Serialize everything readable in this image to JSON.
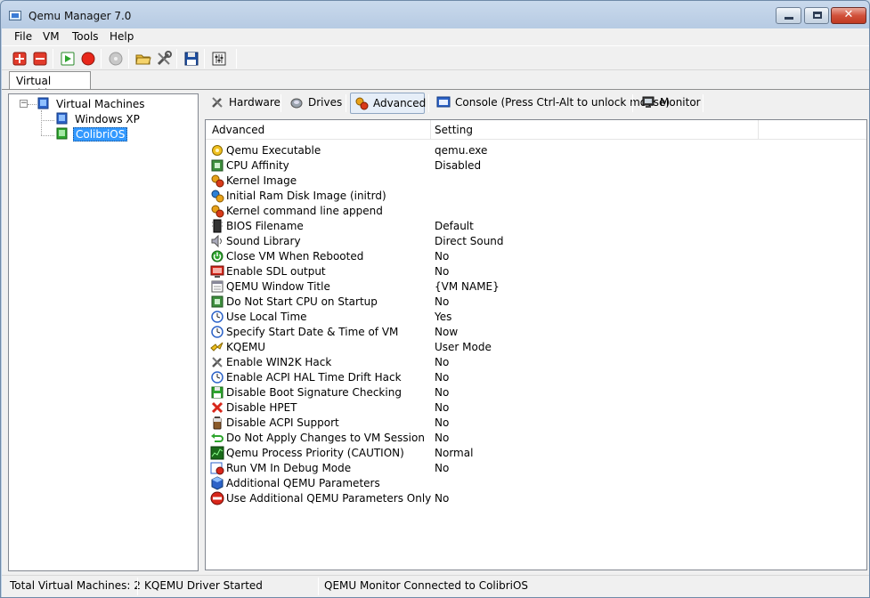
{
  "window": {
    "title": "Qemu Manager 7.0"
  },
  "menu": [
    "File",
    "VM",
    "Tools",
    "Help"
  ],
  "toolbar": {
    "buttons": [
      "add-vm",
      "remove-vm",
      "start-vm",
      "stop-vm",
      "cd-rom",
      "open-folder",
      "tools-settings",
      "save",
      "mixer-settings"
    ]
  },
  "main_tab": {
    "label": "Virtual Machines"
  },
  "tree": {
    "root": "Virtual Machines",
    "children": [
      {
        "label": "Windows XP",
        "selected": false
      },
      {
        "label": "ColibriOS",
        "selected": true
      }
    ]
  },
  "panel_tabs": [
    {
      "label": "Hardware",
      "icon": "wrench-screwdriver-icon",
      "active": false
    },
    {
      "label": "Drives",
      "icon": "drive-icon",
      "active": false
    },
    {
      "label": "Advanced",
      "icon": "gears-icon",
      "active": true
    },
    {
      "label": "Console (Press Ctrl-Alt to unlock mouse)",
      "icon": "console-icon",
      "active": false
    },
    {
      "label": "Monitor",
      "icon": "monitor-icon",
      "active": false
    }
  ],
  "list": {
    "columns": [
      "Advanced",
      "Setting"
    ],
    "rows": [
      {
        "name": "Qemu Executable",
        "value": "qemu.exe",
        "icon": "gear-yellow-icon"
      },
      {
        "name": "CPU Affinity",
        "value": "Disabled",
        "icon": "cpu-icon"
      },
      {
        "name": "Kernel Image",
        "value": "",
        "icon": "gears-red-icon"
      },
      {
        "name": "Initial Ram Disk Image (initrd)",
        "value": "",
        "icon": "gears-blue-icon"
      },
      {
        "name": "Kernel command line append",
        "value": "",
        "icon": "gears-red-icon"
      },
      {
        "name": "BIOS Filename",
        "value": "Default",
        "icon": "bios-chip-icon"
      },
      {
        "name": "Sound Library",
        "value": "Direct Sound",
        "icon": "speaker-icon"
      },
      {
        "name": "Close VM When Rebooted",
        "value": "No",
        "icon": "power-icon"
      },
      {
        "name": "Enable SDL output",
        "value": "No",
        "icon": "display-icon"
      },
      {
        "name": "QEMU Window Title",
        "value": "{VM NAME}",
        "icon": "window-icon"
      },
      {
        "name": "Do Not Start CPU on Startup",
        "value": "No",
        "icon": "cpu-icon"
      },
      {
        "name": "Use Local Time",
        "value": "Yes",
        "icon": "clock-icon"
      },
      {
        "name": "Specify Start Date & Time of VM",
        "value": "Now",
        "icon": "clock-icon"
      },
      {
        "name": "KQEMU",
        "value": "User Mode",
        "icon": "lightning-icon"
      },
      {
        "name": "Enable WIN2K Hack",
        "value": "No",
        "icon": "tools-icon"
      },
      {
        "name": "Enable ACPI HAL Time Drift Hack",
        "value": "No",
        "icon": "clock-icon"
      },
      {
        "name": "Disable Boot Signature Checking",
        "value": "No",
        "icon": "floppy-icon"
      },
      {
        "name": "Disable HPET",
        "value": "No",
        "icon": "red-x-icon"
      },
      {
        "name": "Disable ACPI Support",
        "value": "No",
        "icon": "battery-icon"
      },
      {
        "name": "Do Not Apply Changes to VM Session",
        "value": "No",
        "icon": "undo-arrow-icon"
      },
      {
        "name": "Qemu Process Priority (CAUTION)",
        "value": "Normal",
        "icon": "chart-icon"
      },
      {
        "name": "Run VM In Debug Mode",
        "value": "No",
        "icon": "debug-icon"
      },
      {
        "name": "Additional QEMU Parameters",
        "value": "",
        "icon": "cube-icon"
      },
      {
        "name": "Use Additional QEMU Parameters Only",
        "value": "No",
        "icon": "no-entry-icon"
      }
    ]
  },
  "status": {
    "total": "Total Virtual Machines: 2",
    "kqemu": "KQEMU Driver Started",
    "monitor": "QEMU Monitor Connected to ColibriOS"
  }
}
